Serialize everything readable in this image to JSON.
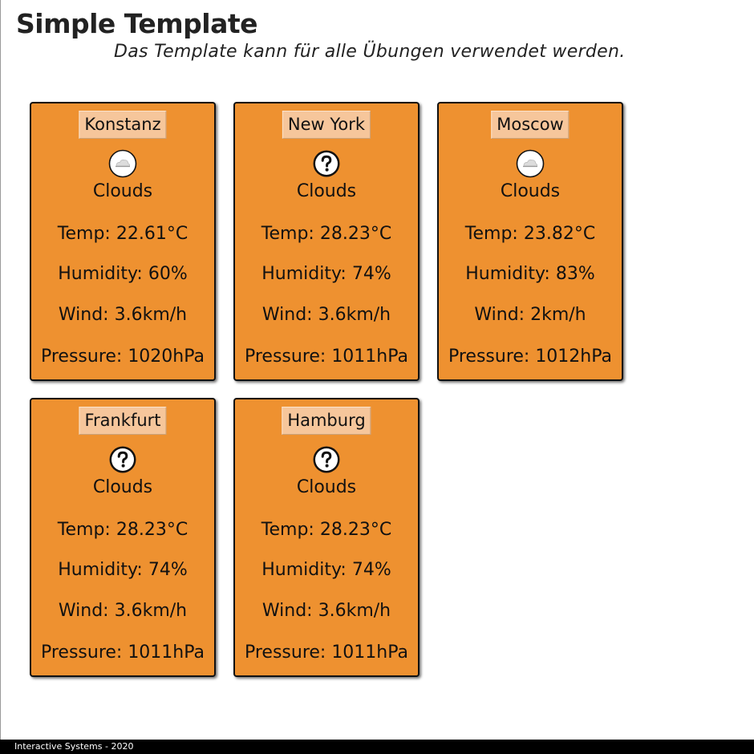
{
  "header": {
    "title": "Simple Template",
    "subtitle": "Das Template kann für alle Übungen verwendet werden."
  },
  "cards": [
    {
      "city": "Konstanz",
      "icon": "cloud-icon",
      "description": "Clouds",
      "temp": "Temp: 22.61°C",
      "humidity": "Humidity: 60%",
      "wind": "Wind: 3.6km/h",
      "pressure": "Pressure: 1020hPa"
    },
    {
      "city": "New York",
      "icon": "question-icon",
      "description": "Clouds",
      "temp": "Temp: 28.23°C",
      "humidity": "Humidity: 74%",
      "wind": "Wind: 3.6km/h",
      "pressure": "Pressure: 1011hPa"
    },
    {
      "city": "Moscow",
      "icon": "cloud-icon",
      "description": "Clouds",
      "temp": "Temp: 23.82°C",
      "humidity": "Humidity: 83%",
      "wind": "Wind: 2km/h",
      "pressure": "Pressure: 1012hPa"
    },
    {
      "city": "Frankfurt",
      "icon": "question-icon",
      "description": "Clouds",
      "temp": "Temp: 28.23°C",
      "humidity": "Humidity: 74%",
      "wind": "Wind: 3.6km/h",
      "pressure": "Pressure: 1011hPa"
    },
    {
      "city": "Hamburg",
      "icon": "question-icon",
      "description": "Clouds",
      "temp": "Temp: 28.23°C",
      "humidity": "Humidity: 74%",
      "wind": "Wind: 3.6km/h",
      "pressure": "Pressure: 1011hPa"
    }
  ],
  "footer": {
    "text": "Interactive Systems - 2020"
  },
  "colors": {
    "card_background": "#ee9130",
    "button_background": "#f6c69b",
    "footer_background": "#000000"
  }
}
